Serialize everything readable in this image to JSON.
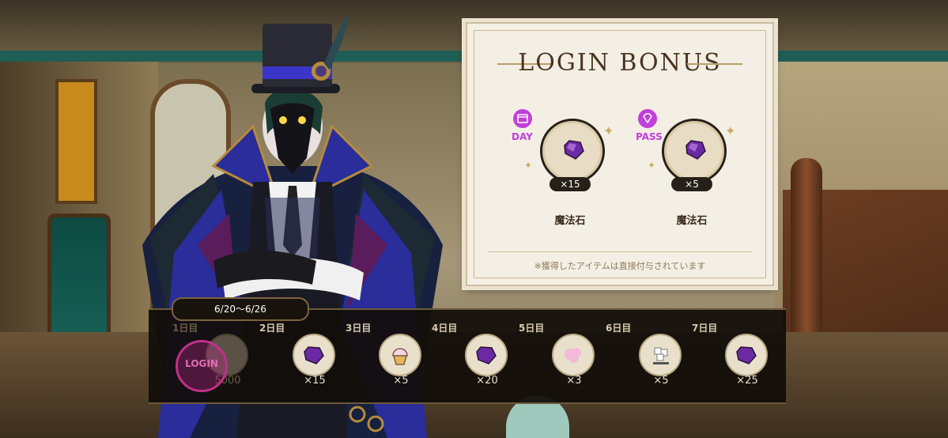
{
  "card": {
    "title": "LOGIN BONUS",
    "day_badge": "DAY",
    "pass_badge": "PASS",
    "day_reward": {
      "name": "魔法石",
      "count": "×15"
    },
    "pass_reward": {
      "name": "魔法石",
      "count": "×5"
    },
    "note": "※獲得したアイテムは直接付与されています"
  },
  "week": {
    "range": "6/20〜6/26",
    "days": [
      {
        "label": "1日目",
        "count": "5000",
        "icon": "madol-icon",
        "status": "claimed"
      },
      {
        "label": "2日目",
        "count": "×15",
        "icon": "magic-stone-icon"
      },
      {
        "label": "3日目",
        "count": "×5",
        "icon": "cupcake-icon"
      },
      {
        "label": "4日目",
        "count": "×20",
        "icon": "magic-stone-icon"
      },
      {
        "label": "5日目",
        "count": "×3",
        "icon": "cotton-candy-icon"
      },
      {
        "label": "6日目",
        "count": "×5",
        "icon": "sugar-cubes-icon"
      },
      {
        "label": "7日目",
        "count": "×25",
        "icon": "magic-stone-icon"
      }
    ],
    "stamp_text": "LOGIN"
  },
  "colors": {
    "accent": "#c040d8",
    "gem": "#6b2aa3",
    "strip": "#120e0a"
  }
}
